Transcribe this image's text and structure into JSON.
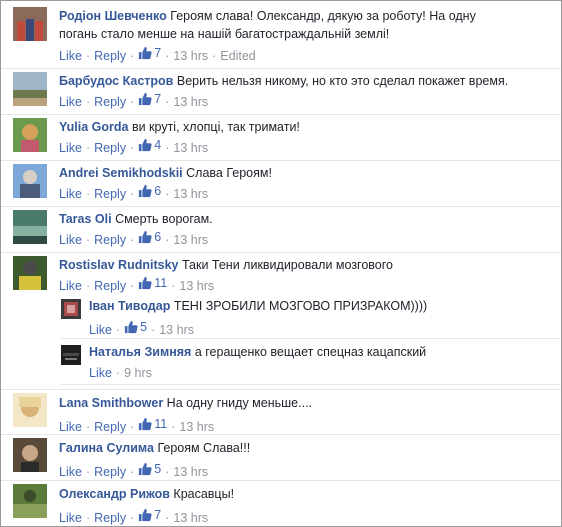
{
  "ui": {
    "like_label": "Like",
    "reply_label": "Reply",
    "separator": "·"
  },
  "comments": [
    {
      "name": "Родіон Шевченко",
      "text": "Героям слава! Олександр, дякую за роботу! На одну",
      "text2": "погань стало менше на нашій багатостраждальній землі!",
      "likes": "7",
      "time": "13 hrs",
      "edited": "Edited",
      "avatar_colors": [
        "#8a6b59",
        "#c24a3c",
        "#3b4a7a"
      ]
    },
    {
      "name": "Барбудос Кастров",
      "text": "Верить нельзя никому, но кто это сделал покажет время.",
      "likes": "7",
      "time": "13 hrs",
      "avatar_colors": [
        "#9fb6c9",
        "#6d7a4f",
        "#b9a27c"
      ]
    },
    {
      "name": "Yulia Gorda",
      "text": "ви круті, хлопці, так тримати!",
      "likes": "4",
      "time": "13 hrs",
      "avatar_colors": [
        "#6b9a4e",
        "#d4a05a",
        "#c25a6e"
      ]
    },
    {
      "name": "Andrei Semikhodskii",
      "text": "Слава Героям!",
      "likes": "6",
      "time": "13 hrs",
      "avatar_colors": [
        "#7da7d6",
        "#d8cfc4",
        "#4b5d7a"
      ]
    },
    {
      "name": "Taras Oli",
      "text": "Смерть ворогам.",
      "likes": "6",
      "time": "13 hrs",
      "avatar_colors": [
        "#4a7a6a",
        "#86b0a0",
        "#2f4a44"
      ]
    },
    {
      "name": "Rostislav Rudnitsky",
      "text": "Таки Тени ликвидировали мозгового",
      "likes": "11",
      "time": "13 hrs",
      "avatar_colors": [
        "#3d5a2e",
        "#d6c23a",
        "#4a4a4a"
      ]
    },
    {
      "name": "Lana Smithbower",
      "text": "На одну гниду меньше....",
      "likes": "11",
      "time": "13 hrs",
      "avatar_colors": [
        "#e8d49a",
        "#d9b27a",
        "#f3e7c8"
      ]
    },
    {
      "name": "Галина Сулима",
      "text": "Героям Слава!!!",
      "likes": "5",
      "time": "13 hrs",
      "avatar_colors": [
        "#5a4a3a",
        "#c9a88a",
        "#2a2a2a"
      ]
    },
    {
      "name": "Олександр Рижов",
      "text": "Красавцы!",
      "likes": "7",
      "time": "13 hrs",
      "avatar_colors": [
        "#5c7a3a",
        "#8aa05a",
        "#3a4a2a"
      ]
    }
  ],
  "replies": [
    {
      "name": "Іван Тиводар",
      "text": "ТЕНІ ЗРОБИЛИ МОЗГОВО ПРИЗРАКОМ))))",
      "likes": "5",
      "time": "13 hrs",
      "avatar_colors": [
        "#a94a4a",
        "#3a3a3a",
        "#d9a0a0"
      ]
    },
    {
      "name": "Наталья Зимняя",
      "text": "а геращенко вещает спецназ кацапский",
      "time": "9 hrs",
      "avatar_colors": [
        "#1e1e1e",
        "#4a4a4a",
        "#7a7a7a"
      ]
    }
  ]
}
